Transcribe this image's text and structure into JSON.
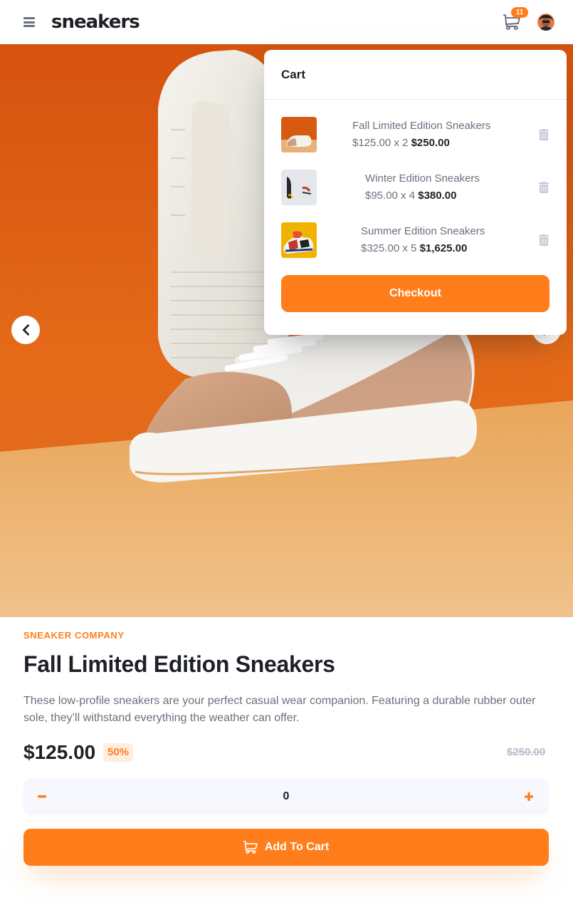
{
  "header": {
    "logo": "sneakers",
    "cart_count": "11"
  },
  "cart": {
    "title": "Cart",
    "items": [
      {
        "name": "Fall Limited Edition Sneakers",
        "unit_price": "$125.00 x 2",
        "total": "$250.00"
      },
      {
        "name": "Winter Edition Sneakers",
        "unit_price": "$95.00 x 4",
        "total": "$380.00"
      },
      {
        "name": "Summer Edition Sneakers",
        "unit_price": "$325.00 x 5",
        "total": "$1,625.00"
      }
    ],
    "checkout_label": "Checkout"
  },
  "product": {
    "company": "SNEAKER COMPANY",
    "title": "Fall Limited Edition Sneakers",
    "description": "These low-profile sneakers are your perfect casual wear companion. Featuring a durable rubber outer sole, they’ll withstand everything the weather can offer.",
    "price": "$125.00",
    "discount": "50%",
    "old_price": "$250.00"
  },
  "quantity": {
    "value": "0",
    "minus_label": "−",
    "plus_label": "+"
  },
  "add_to_cart_label": "Add To Cart",
  "icons": {
    "menu": "menu-icon",
    "cart": "cart-icon",
    "avatar": "avatar",
    "prev": "chevron-left-icon",
    "next": "chevron-right-icon",
    "delete": "trash-icon",
    "minus": "minus-icon",
    "plus": "plus-icon"
  },
  "colors": {
    "accent": "#ff7e1b",
    "accent_pale": "#ffede0",
    "dark": "#1d2026",
    "grey": "#69707d",
    "light_grey": "#b6bcc8",
    "qty_bg": "#f6f8fd"
  }
}
